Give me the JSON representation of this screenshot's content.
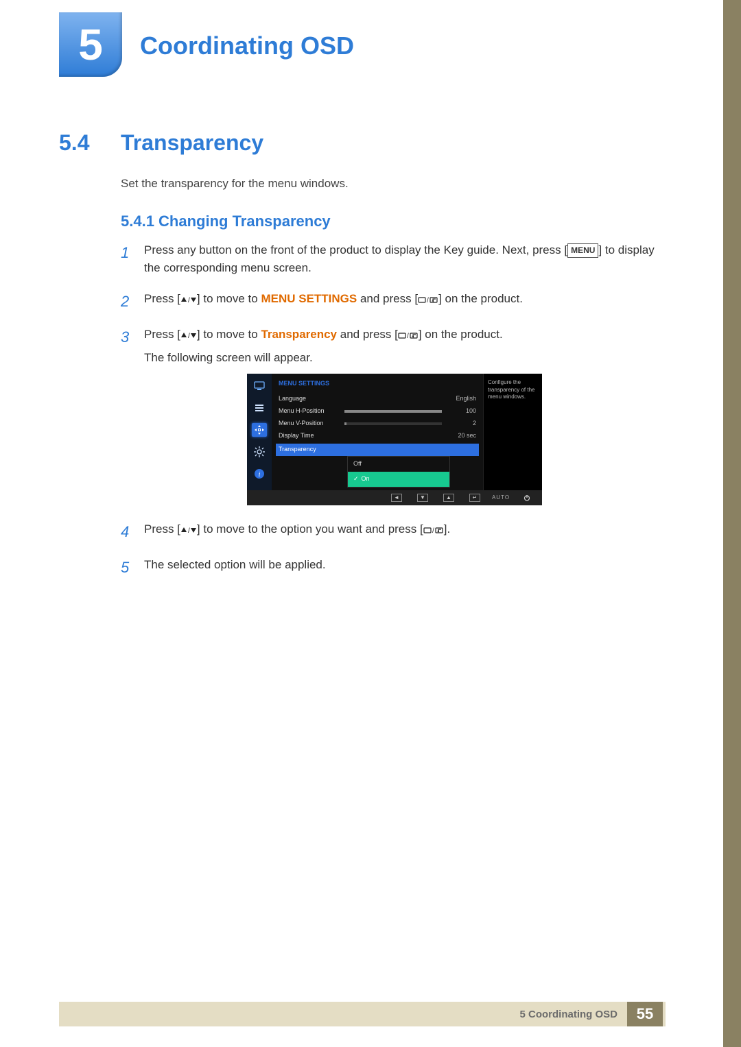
{
  "chapter": {
    "number": "5",
    "title": "Coordinating OSD"
  },
  "section": {
    "number": "5.4",
    "title": "Transparency",
    "intro": "Set the transparency for the menu windows."
  },
  "subsection": {
    "number": "5.4.1",
    "title": "Changing Transparency",
    "combined": "5.4.1   Changing Transparency"
  },
  "menu_key_label": "MENU",
  "steps": {
    "s1a": "Press any button on the front of the product to display the Key guide. Next, press [",
    "s1b": "] to display the corresponding menu screen.",
    "s2a": "Press [",
    "s2b": "] to move to ",
    "s2c": "MENU SETTINGS",
    "s2d": " and press [",
    "s2e": "] on the product.",
    "s3a": "Press [",
    "s3b": "] to move to ",
    "s3c": "Transparency",
    "s3d": " and press [",
    "s3e": "] on the product.",
    "s3f": "The following screen will appear.",
    "s4a": "Press [",
    "s4b": "] to move to the option you want and press [",
    "s4c": "].",
    "s5": "The selected option will be applied."
  },
  "osd": {
    "header": "MENU SETTINGS",
    "rows": [
      {
        "label": "Language",
        "value": "English",
        "bar": null
      },
      {
        "label": "Menu H-Position",
        "value": "100",
        "bar": 100
      },
      {
        "label": "Menu V-Position",
        "value": "2",
        "bar": 2
      },
      {
        "label": "Display Time",
        "value": "20 sec",
        "bar": null
      }
    ],
    "selected_label": "Transparency",
    "dropdown": {
      "off": "Off",
      "on": "On"
    },
    "help": "Configure the transparency of the menu windows.",
    "bottom_auto": "AUTO"
  },
  "footer": {
    "chapter_ref": "5 Coordinating OSD",
    "page": "55"
  }
}
